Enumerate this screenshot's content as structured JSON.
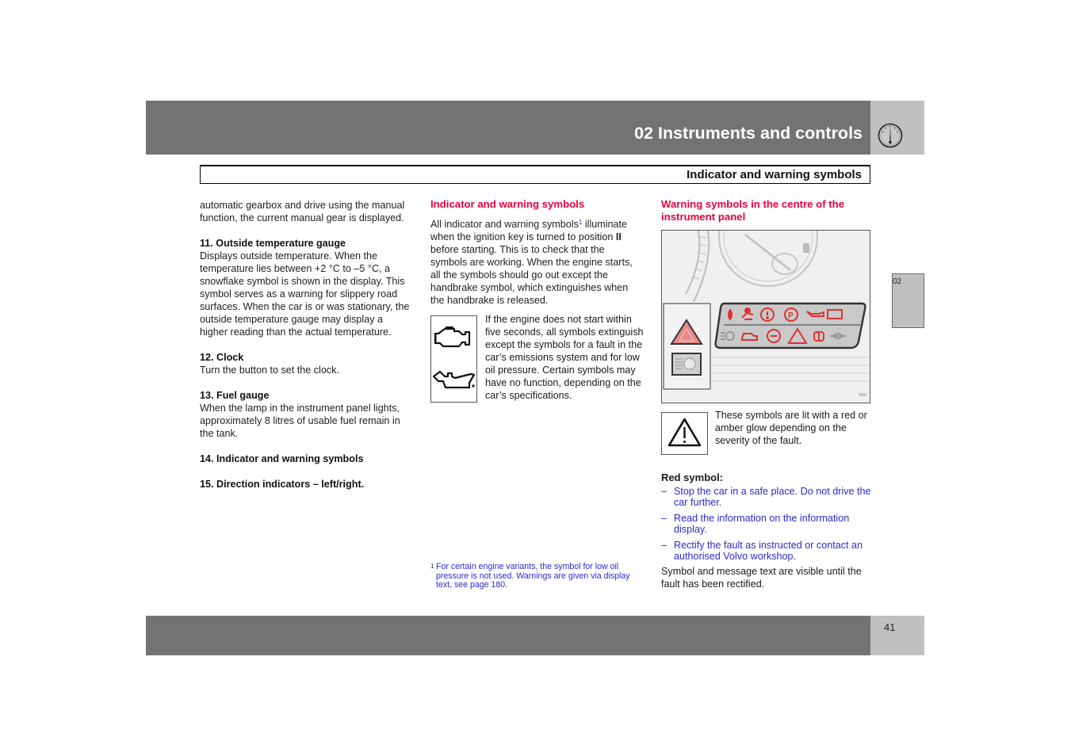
{
  "header": {
    "chapter_title": "02 Instruments and controls",
    "chapter_icon": "speedometer-gauge-icon",
    "section_title": "Indicator and warning symbols"
  },
  "column1": {
    "intro": "automatic gearbox and drive using the manual function, the current manual gear is displayed.",
    "items": [
      {
        "heading": "11. Outside temperature gauge",
        "body": "Displays outside temperature. When the temperature lies between +2 °C to –5 °C, a snowflake symbol is shown in the display. This symbol serves as a warning for slippery road surfaces. When the car is or was stationary, the outside temperature gauge may display a higher reading than the actual temperature."
      },
      {
        "heading": "12. Clock",
        "body": "Turn the button to set the clock."
      },
      {
        "heading": "13. Fuel gauge",
        "body": "When the lamp in the instrument panel lights, approximately 8 litres of usable fuel remain in the tank."
      },
      {
        "heading": "14. Indicator and warning symbols",
        "body": ""
      },
      {
        "heading": "15. Direction indicators – left/right.",
        "body": ""
      }
    ]
  },
  "column2": {
    "heading": "Indicator and warning symbols",
    "para1_before": "All indicator and warning symbols",
    "para1_sup": "1",
    "para1_after": " illuminate when the ignition key is turned to position ",
    "para1_bold": "II",
    "para1_end": " before starting. This is to check that the symbols are working. When the engine starts, all the symbols should go out except the handbrake symbol, which extinguishes when the handbrake is released.",
    "icons": [
      "engine-check-icon",
      "oil-pressure-icon"
    ],
    "para2": "If the engine does not start within five seconds, all symbols extinguish except the symbols for a fault in the car’s emissions system and for low oil pressure. Certain symbols may have no function, depending on the car’s specifications.",
    "footnote_number": "1",
    "footnote_text": "For certain engine variants, the symbol for low oil pressure is not used. Warnings are given via display text, see page 180."
  },
  "column3": {
    "heading": "Warning symbols in the centre of the instrument panel",
    "figure": "instrument-panel-warning-symbols-illustration",
    "warning_icon": "warning-triangle-icon",
    "warning_text": "These symbols are lit with a red or amber glow depending on the severity of the fault.",
    "red_symbol_heading": "Red symbol:",
    "red_symbol_steps": [
      "Stop the car in a safe place. Do not drive the car further.",
      "Read the information on the information display.",
      "Rectify the fault as instructed or contact an authorised Volvo workshop."
    ],
    "dash": "–",
    "closing_text": "Symbol and message text are visible until the fault has been rectified."
  },
  "side_tab": {
    "label": "02"
  },
  "footer": {
    "page_number": "41"
  },
  "colors": {
    "band_gray": "#737373",
    "tab_gray": "#c0c0c0",
    "heading_red": "#e4003a",
    "step_blue": "#2a2ad0",
    "symbol_red": "#e03030"
  }
}
